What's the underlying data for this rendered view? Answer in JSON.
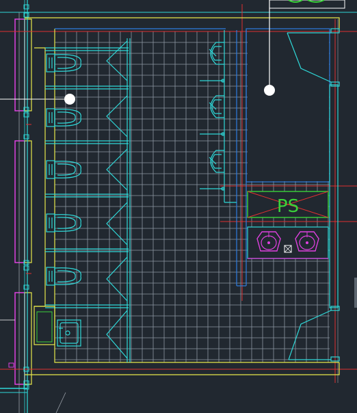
{
  "drawing": {
    "background": "#212830",
    "colors": {
      "wall": "#e8e84a",
      "fixture": "#2fd8d8",
      "grid": "#8e97a3",
      "red_axis": "#e03030",
      "magenta": "#e040e0",
      "green": "#3ad23a",
      "blue_line": "#2f7de0",
      "white": "#ffffff"
    },
    "shaft_label": "PS",
    "fixtures": {
      "toilets": 5,
      "urinals": 3,
      "basins": 2,
      "accessible_sink": 1
    },
    "icons": [
      "toilet-icon",
      "urinal-icon",
      "basin-icon",
      "floor-drain-icon",
      "column-marker-icon"
    ]
  }
}
